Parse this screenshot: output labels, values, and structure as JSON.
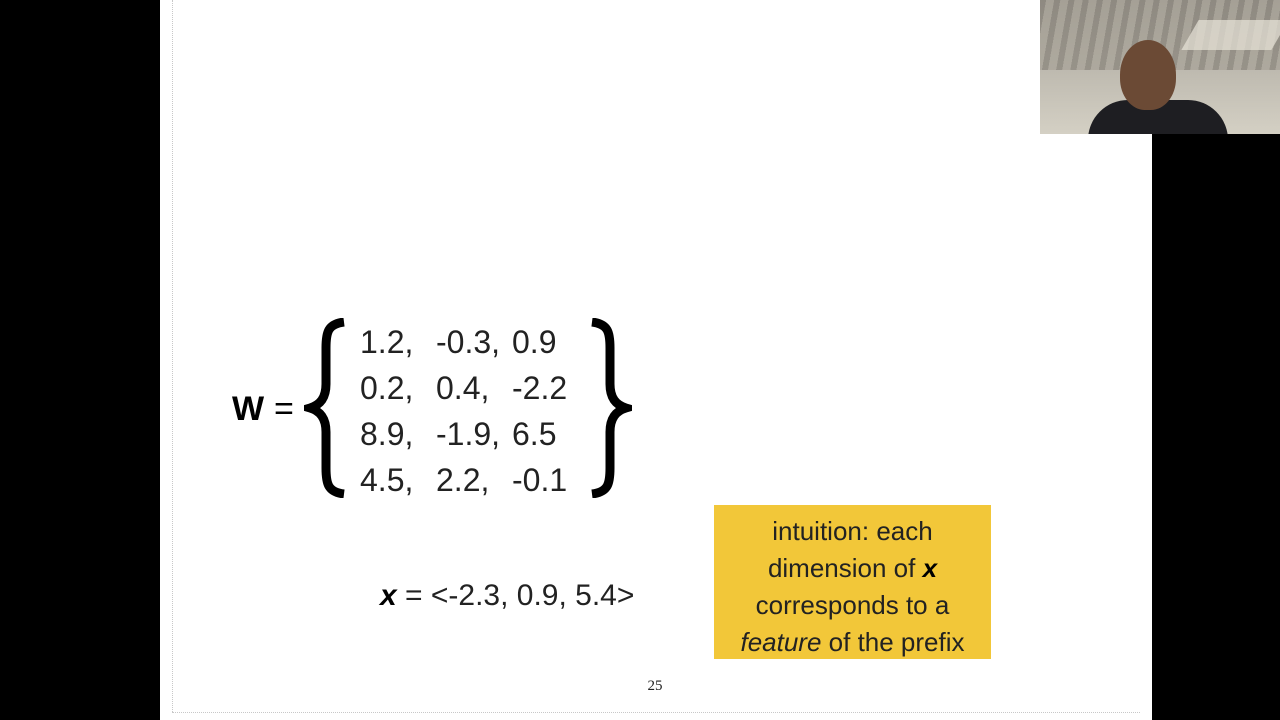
{
  "slide": {
    "w_label": "W",
    "w_equals": "=",
    "matrix": [
      [
        "1.2,",
        "-0.3,",
        "0.9"
      ],
      [
        "0.2,",
        "0.4,",
        "-2.2"
      ],
      [
        "8.9,",
        "-1.9,",
        "6.5"
      ],
      [
        "4.5,",
        "2.2,",
        "-0.1"
      ]
    ],
    "x_var": "x",
    "x_rest": " = <-2.3, 0.9, 5.4>",
    "callout": {
      "line1": "intuition: each",
      "line2_pre": "dimension of ",
      "line2_var": "x",
      "line3": "corresponds to a",
      "line4_italic": "feature",
      "line4_rest": " of the prefix"
    },
    "page_number": "25"
  },
  "colors": {
    "callout_bg": "#f2c739",
    "letterbox": "#000000",
    "slide_bg": "#ffffff"
  },
  "icons": {
    "webcam": "presenter-webcam-feed"
  }
}
